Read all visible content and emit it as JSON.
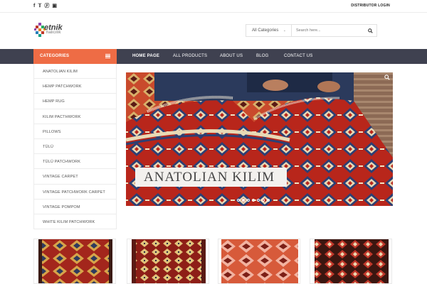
{
  "topbar": {
    "social": [
      {
        "icon": "facebook-icon",
        "glyph": "f"
      },
      {
        "icon": "twitter-icon",
        "glyph": "•"
      },
      {
        "icon": "pinterest-icon",
        "glyph": "ⓟ"
      },
      {
        "icon": "instagram-icon",
        "glyph": "▣"
      }
    ],
    "distributor_login": "DISTRIBUTOR LOGIN"
  },
  "logo": {
    "line1": "etnik",
    "line2": "halıcılık"
  },
  "search": {
    "category_selected": "All Categories",
    "placeholder": "Search here..."
  },
  "nav": {
    "categories_label": "CATEGORIES",
    "items": [
      {
        "label": "HOME PAGE",
        "active": true
      },
      {
        "label": "ALL PRODUCTS",
        "active": false
      },
      {
        "label": "ABOUT US",
        "active": false
      },
      {
        "label": "BLOG",
        "active": false
      },
      {
        "label": "CONTACT US",
        "active": false
      }
    ]
  },
  "sidebar": {
    "items": [
      "ANATOLIAN KILIM",
      "HEMP PATCHWORK",
      "HEMP RUG",
      "KILIM PACTHWORK",
      "PILLOWS",
      "TÜLÜ",
      "TÜLÜ PATCHWORK",
      "VINTAGE CARPET",
      "VINTAGE PATCHWORK CARPET",
      "VINTAGE POMPOM",
      "WHITE KILIM PATCHWORK"
    ]
  },
  "hero": {
    "caption": "ANATOLIAN KILIM",
    "slide_count": 7,
    "active_slide": 2
  },
  "colors": {
    "accent": "#ee6c45",
    "nav_bg": "#3f4150",
    "rug_red": "#b8261b",
    "rug_dark": "#5a1a14"
  }
}
